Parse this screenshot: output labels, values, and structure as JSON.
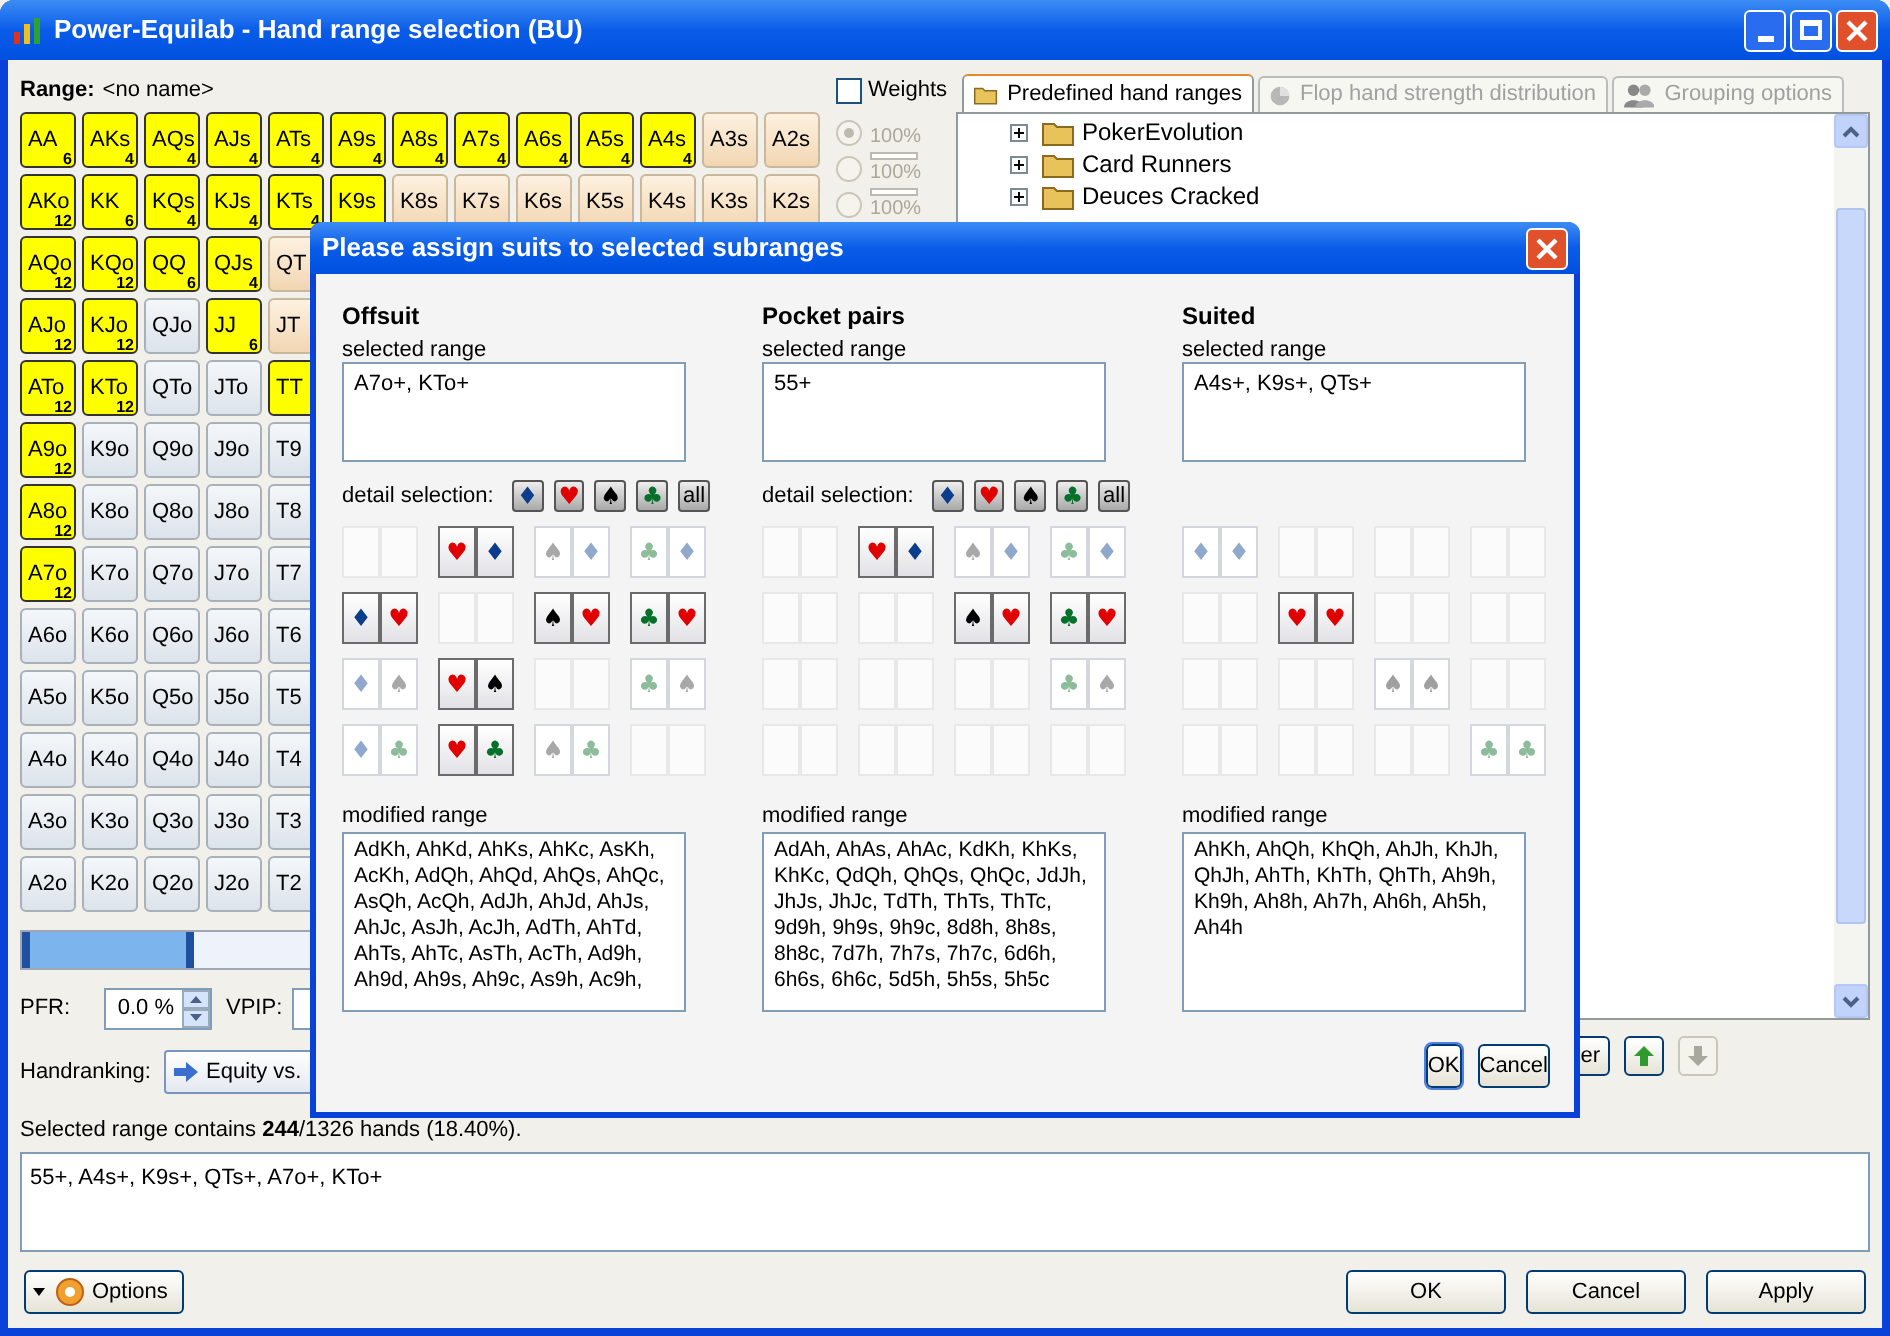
{
  "window": {
    "title": "Power-Equilab - Hand range selection (BU)"
  },
  "range": {
    "label": "Range:",
    "name": "<no name>"
  },
  "hand_grid": {
    "rows": [
      [
        {
          "label": "AA",
          "count": "6",
          "kind": "pair",
          "selected": true
        },
        {
          "label": "AKs",
          "count": "4",
          "kind": "suited",
          "selected": true
        },
        {
          "label": "AQs",
          "count": "4",
          "kind": "suited",
          "selected": true
        },
        {
          "label": "AJs",
          "count": "4",
          "kind": "suited",
          "selected": true
        },
        {
          "label": "ATs",
          "count": "4",
          "kind": "suited",
          "selected": true
        },
        {
          "label": "A9s",
          "count": "4",
          "kind": "suited",
          "selected": true
        },
        {
          "label": "A8s",
          "count": "4",
          "kind": "suited",
          "selected": true
        },
        {
          "label": "A7s",
          "count": "4",
          "kind": "suited",
          "selected": true
        },
        {
          "label": "A6s",
          "count": "4",
          "kind": "suited",
          "selected": true
        },
        {
          "label": "A5s",
          "count": "4",
          "kind": "suited",
          "selected": true
        },
        {
          "label": "A4s",
          "count": "4",
          "kind": "suited",
          "selected": true
        },
        {
          "label": "A3s",
          "kind": "suited",
          "selected": false
        },
        {
          "label": "A2s",
          "kind": "suited",
          "selected": false
        }
      ],
      [
        {
          "label": "AKo",
          "count": "12",
          "kind": "offsuit",
          "selected": true
        },
        {
          "label": "KK",
          "count": "6",
          "kind": "pair",
          "selected": true
        },
        {
          "label": "KQs",
          "count": "4",
          "kind": "suited",
          "selected": true
        },
        {
          "label": "KJs",
          "count": "4",
          "kind": "suited",
          "selected": true
        },
        {
          "label": "KTs",
          "count": "4",
          "kind": "suited",
          "selected": true
        },
        {
          "label": "K9s",
          "kind": "suited",
          "selected": true
        },
        {
          "label": "K8s",
          "kind": "suited",
          "selected": false
        },
        {
          "label": "K7s",
          "kind": "suited",
          "selected": false
        },
        {
          "label": "K6s",
          "kind": "suited",
          "selected": false
        },
        {
          "label": "K5s",
          "kind": "suited",
          "selected": false
        },
        {
          "label": "K4s",
          "kind": "suited",
          "selected": false
        },
        {
          "label": "K3s",
          "kind": "suited",
          "selected": false
        },
        {
          "label": "K2s",
          "kind": "suited",
          "selected": false
        }
      ],
      [
        {
          "label": "AQo",
          "count": "12",
          "kind": "offsuit",
          "selected": true
        },
        {
          "label": "KQo",
          "count": "12",
          "kind": "offsuit",
          "selected": true
        },
        {
          "label": "QQ",
          "count": "6",
          "kind": "pair",
          "selected": true
        },
        {
          "label": "QJs",
          "count": "4",
          "kind": "suited",
          "selected": true
        },
        {
          "label": "QT",
          "kind": "suited",
          "selected": false
        }
      ],
      [
        {
          "label": "AJo",
          "count": "12",
          "kind": "offsuit",
          "selected": true
        },
        {
          "label": "KJo",
          "count": "12",
          "kind": "offsuit",
          "selected": true
        },
        {
          "label": "QJo",
          "kind": "offsuit",
          "selected": false
        },
        {
          "label": "JJ",
          "count": "6",
          "kind": "pair",
          "selected": true
        },
        {
          "label": "JT",
          "kind": "suited",
          "selected": false
        }
      ],
      [
        {
          "label": "ATo",
          "count": "12",
          "kind": "offsuit",
          "selected": true
        },
        {
          "label": "KTo",
          "count": "12",
          "kind": "offsuit",
          "selected": true
        },
        {
          "label": "QTo",
          "kind": "offsuit",
          "selected": false
        },
        {
          "label": "JTo",
          "kind": "offsuit",
          "selected": false
        },
        {
          "label": "TT",
          "kind": "pair",
          "selected": true
        }
      ],
      [
        {
          "label": "A9o",
          "count": "12",
          "kind": "offsuit",
          "selected": true
        },
        {
          "label": "K9o",
          "kind": "offsuit",
          "selected": false
        },
        {
          "label": "Q9o",
          "kind": "offsuit",
          "selected": false
        },
        {
          "label": "J9o",
          "kind": "offsuit",
          "selected": false
        },
        {
          "label": "T9",
          "kind": "offsuit",
          "selected": false
        }
      ],
      [
        {
          "label": "A8o",
          "count": "12",
          "kind": "offsuit",
          "selected": true
        },
        {
          "label": "K8o",
          "kind": "offsuit",
          "selected": false
        },
        {
          "label": "Q8o",
          "kind": "offsuit",
          "selected": false
        },
        {
          "label": "J8o",
          "kind": "offsuit",
          "selected": false
        },
        {
          "label": "T8",
          "kind": "offsuit",
          "selected": false
        }
      ],
      [
        {
          "label": "A7o",
          "count": "12",
          "kind": "offsuit",
          "selected": true
        },
        {
          "label": "K7o",
          "kind": "offsuit",
          "selected": false
        },
        {
          "label": "Q7o",
          "kind": "offsuit",
          "selected": false
        },
        {
          "label": "J7o",
          "kind": "offsuit",
          "selected": false
        },
        {
          "label": "T7",
          "kind": "offsuit",
          "selected": false
        }
      ],
      [
        {
          "label": "A6o",
          "kind": "offsuit",
          "selected": false
        },
        {
          "label": "K6o",
          "kind": "offsuit",
          "selected": false
        },
        {
          "label": "Q6o",
          "kind": "offsuit",
          "selected": false
        },
        {
          "label": "J6o",
          "kind": "offsuit",
          "selected": false
        },
        {
          "label": "T6",
          "kind": "offsuit",
          "selected": false
        }
      ],
      [
        {
          "label": "A5o",
          "kind": "offsuit",
          "selected": false
        },
        {
          "label": "K5o",
          "kind": "offsuit",
          "selected": false
        },
        {
          "label": "Q5o",
          "kind": "offsuit",
          "selected": false
        },
        {
          "label": "J5o",
          "kind": "offsuit",
          "selected": false
        },
        {
          "label": "T5",
          "kind": "offsuit",
          "selected": false
        }
      ],
      [
        {
          "label": "A4o",
          "kind": "offsuit",
          "selected": false
        },
        {
          "label": "K4o",
          "kind": "offsuit",
          "selected": false
        },
        {
          "label": "Q4o",
          "kind": "offsuit",
          "selected": false
        },
        {
          "label": "J4o",
          "kind": "offsuit",
          "selected": false
        },
        {
          "label": "T4",
          "kind": "offsuit",
          "selected": false
        }
      ],
      [
        {
          "label": "A3o",
          "kind": "offsuit",
          "selected": false
        },
        {
          "label": "K3o",
          "kind": "offsuit",
          "selected": false
        },
        {
          "label": "Q3o",
          "kind": "offsuit",
          "selected": false
        },
        {
          "label": "J3o",
          "kind": "offsuit",
          "selected": false
        },
        {
          "label": "T3",
          "kind": "offsuit",
          "selected": false
        }
      ],
      [
        {
          "label": "A2o",
          "kind": "offsuit",
          "selected": false
        },
        {
          "label": "K2o",
          "kind": "offsuit",
          "selected": false
        },
        {
          "label": "Q2o",
          "kind": "offsuit",
          "selected": false
        },
        {
          "label": "J2o",
          "kind": "offsuit",
          "selected": false
        },
        {
          "label": "T2",
          "kind": "offsuit",
          "selected": false
        }
      ]
    ]
  },
  "weights": {
    "label": "Weights",
    "checked": false,
    "options": [
      {
        "label": "100%",
        "kind": "plain",
        "selected": true
      },
      {
        "label": "100%",
        "kind": "bar",
        "selected": false
      },
      {
        "label": "100%",
        "kind": "bar",
        "selected": false
      }
    ]
  },
  "tabs": [
    {
      "label": "Predefined hand ranges",
      "selected": true,
      "disabled": false
    },
    {
      "label": "Flop hand strength distribution",
      "selected": false,
      "disabled": true
    },
    {
      "label": "Grouping options",
      "selected": false,
      "disabled": true
    }
  ],
  "tree": [
    {
      "label": "PokerEvolution",
      "expanded": false
    },
    {
      "label": "Card Runners",
      "expanded": false
    },
    {
      "label": "Deuces Cracked",
      "expanded": false
    }
  ],
  "panel_buttons": [
    {
      "kind": "text",
      "label": "er"
    },
    {
      "kind": "up",
      "disabled": false
    },
    {
      "kind": "down",
      "disabled": true
    }
  ],
  "slider": {
    "level": 0.29
  },
  "pfr": {
    "label": "PFR:",
    "value": "0.0 %"
  },
  "vpip": {
    "label": "VPIP:"
  },
  "handranking": {
    "label": "Handranking:",
    "button": "Equity vs."
  },
  "summary": "Selected range contains **244**/1326 hands (18.40%).",
  "range_text": "55+, A4s+, K9s+, QTs+, A7o+, KTo+",
  "bottom": {
    "options": "Options",
    "buttons": [
      "OK",
      "Cancel",
      "Apply"
    ]
  },
  "dialog": {
    "title": "Please assign suits to selected subranges",
    "sections": [
      {
        "heading": "Offsuit",
        "selected_label": "selected range",
        "selected_value": "A7o+, KTo+",
        "detail_label": "detail selection:",
        "detail_buttons": [
          {
            "kind": "suit",
            "suit": "♦",
            "color": "#0b3d8c"
          },
          {
            "kind": "suit",
            "suit": "♥",
            "color": "#e00000"
          },
          {
            "kind": "suit",
            "suit": "♠",
            "color": "#000000"
          },
          {
            "kind": "suit",
            "suit": "♣",
            "color": "#05702a"
          },
          {
            "kind": "text",
            "label": "all"
          }
        ],
        "combos": [
          [
            {
              "kind": "blank"
            },
            {
              "kind": "pair",
              "cards": [
                {
                  "suit": "♥",
                  "color": "#e00000"
                },
                {
                  "suit": "♦",
                  "color": "#0b3d8c"
                }
              ],
              "selected": true
            },
            {
              "kind": "pair",
              "cards": [
                {
                  "suit": "♠",
                  "color": "#a8a8a8"
                },
                {
                  "suit": "♦",
                  "color": "#8fa8cc"
                }
              ],
              "selected": false
            },
            {
              "kind": "pair",
              "cards": [
                {
                  "suit": "♣",
                  "color": "#8cbc9a"
                },
                {
                  "suit": "♦",
                  "color": "#8fa8cc"
                }
              ],
              "selected": false
            }
          ],
          [
            {
              "kind": "pair",
              "cards": [
                {
                  "suit": "♦",
                  "color": "#0b3d8c"
                },
                {
                  "suit": "♥",
                  "color": "#e00000"
                }
              ],
              "selected": true
            },
            {
              "kind": "blank"
            },
            {
              "kind": "pair",
              "cards": [
                {
                  "suit": "♠",
                  "color": "#000000"
                },
                {
                  "suit": "♥",
                  "color": "#e00000"
                }
              ],
              "selected": true
            },
            {
              "kind": "pair",
              "cards": [
                {
                  "suit": "♣",
                  "color": "#05702a"
                },
                {
                  "suit": "♥",
                  "color": "#e00000"
                }
              ],
              "selected": true
            }
          ],
          [
            {
              "kind": "pair",
              "cards": [
                {
                  "suit": "♦",
                  "color": "#8fa8cc"
                },
                {
                  "suit": "♠",
                  "color": "#a8a8a8"
                }
              ],
              "selected": false
            },
            {
              "kind": "pair",
              "cards": [
                {
                  "suit": "♥",
                  "color": "#e00000"
                },
                {
                  "suit": "♠",
                  "color": "#000000"
                }
              ],
              "selected": true
            },
            {
              "kind": "blank"
            },
            {
              "kind": "pair",
              "cards": [
                {
                  "suit": "♣",
                  "color": "#8cbc9a"
                },
                {
                  "suit": "♠",
                  "color": "#a8a8a8"
                }
              ],
              "selected": false
            }
          ],
          [
            {
              "kind": "pair",
              "cards": [
                {
                  "suit": "♦",
                  "color": "#8fa8cc"
                },
                {
                  "suit": "♣",
                  "color": "#8cbc9a"
                }
              ],
              "selected": false
            },
            {
              "kind": "pair",
              "cards": [
                {
                  "suit": "♥",
                  "color": "#e00000"
                },
                {
                  "suit": "♣",
                  "color": "#05702a"
                }
              ],
              "selected": true
            },
            {
              "kind": "pair",
              "cards": [
                {
                  "suit": "♠",
                  "color": "#a8a8a8"
                },
                {
                  "suit": "♣",
                  "color": "#8cbc9a"
                }
              ],
              "selected": false
            },
            {
              "kind": "blank"
            }
          ]
        ],
        "modified_label": "modified range",
        "modified_value": "AdKh, AhKd, AhKs, AhKc, AsKh, AcKh, AdQh, AhQd, AhQs, AhQc, AsQh, AcQh, AdJh, AhJd, AhJs, AhJc, AsJh, AcJh, AdTh, AhTd, AhTs, AhTc, AsTh, AcTh, Ad9h, Ah9d, Ah9s, Ah9c, As9h, Ac9h,"
      },
      {
        "heading": "Pocket pairs",
        "selected_label": "selected range",
        "selected_value": "55+",
        "detail_label": "detail selection:",
        "detail_buttons": [
          {
            "kind": "suit",
            "suit": "♦",
            "color": "#0b3d8c"
          },
          {
            "kind": "suit",
            "suit": "♥",
            "color": "#e00000"
          },
          {
            "kind": "suit",
            "suit": "♠",
            "color": "#000000"
          },
          {
            "kind": "suit",
            "suit": "♣",
            "color": "#05702a"
          },
          {
            "kind": "text",
            "label": "all"
          }
        ],
        "combos": [
          [
            {
              "kind": "blank"
            },
            {
              "kind": "pair",
              "cards": [
                {
                  "suit": "♥",
                  "color": "#e00000"
                },
                {
                  "suit": "♦",
                  "color": "#0b3d8c"
                }
              ],
              "selected": true
            },
            {
              "kind": "pair",
              "cards": [
                {
                  "suit": "♠",
                  "color": "#a8a8a8"
                },
                {
                  "suit": "♦",
                  "color": "#8fa8cc"
                }
              ],
              "selected": false
            },
            {
              "kind": "pair",
              "cards": [
                {
                  "suit": "♣",
                  "color": "#8cbc9a"
                },
                {
                  "suit": "♦",
                  "color": "#8fa8cc"
                }
              ],
              "selected": false
            }
          ],
          [
            {
              "kind": "blank"
            },
            {
              "kind": "blank"
            },
            {
              "kind": "pair",
              "cards": [
                {
                  "suit": "♠",
                  "color": "#000000"
                },
                {
                  "suit": "♥",
                  "color": "#e00000"
                }
              ],
              "selected": true
            },
            {
              "kind": "pair",
              "cards": [
                {
                  "suit": "♣",
                  "color": "#05702a"
                },
                {
                  "suit": "♥",
                  "color": "#e00000"
                }
              ],
              "selected": true
            }
          ],
          [
            {
              "kind": "blank"
            },
            {
              "kind": "blank"
            },
            {
              "kind": "blank"
            },
            {
              "kind": "pair",
              "cards": [
                {
                  "suit": "♣",
                  "color": "#8cbc9a"
                },
                {
                  "suit": "♠",
                  "color": "#a8a8a8"
                }
              ],
              "selected": false
            }
          ],
          [
            {
              "kind": "blank"
            },
            {
              "kind": "blank"
            },
            {
              "kind": "blank"
            },
            {
              "kind": "blank"
            }
          ]
        ],
        "modified_label": "modified range",
        "modified_value": "AdAh, AhAs, AhAc, KdKh, KhKs, KhKc, QdQh, QhQs, QhQc, JdJh, JhJs, JhJc, TdTh, ThTs, ThTc, 9d9h, 9h9s, 9h9c, 8d8h, 8h8s, 8h8c, 7d7h, 7h7s, 7h7c, 6d6h, 6h6s, 6h6c, 5d5h, 5h5s, 5h5c"
      },
      {
        "heading": "Suited",
        "selected_label": "selected range",
        "selected_value": "A4s+, K9s+, QTs+",
        "combos": [
          [
            {
              "kind": "pair",
              "cards": [
                {
                  "suit": "♦",
                  "color": "#8fa8cc"
                },
                {
                  "suit": "♦",
                  "color": "#8fa8cc"
                }
              ],
              "selected": false
            },
            {
              "kind": "blank"
            },
            {
              "kind": "blank"
            },
            {
              "kind": "blank"
            }
          ],
          [
            {
              "kind": "blank"
            },
            {
              "kind": "pair",
              "cards": [
                {
                  "suit": "♥",
                  "color": "#e00000"
                },
                {
                  "suit": "♥",
                  "color": "#e00000"
                }
              ],
              "selected": true
            },
            {
              "kind": "blank"
            },
            {
              "kind": "blank"
            }
          ],
          [
            {
              "kind": "blank"
            },
            {
              "kind": "blank"
            },
            {
              "kind": "pair",
              "cards": [
                {
                  "suit": "♠",
                  "color": "#a0a0a0"
                },
                {
                  "suit": "♠",
                  "color": "#a0a0a0"
                }
              ],
              "selected": false
            },
            {
              "kind": "blank"
            }
          ],
          [
            {
              "kind": "blank"
            },
            {
              "kind": "blank"
            },
            {
              "kind": "blank"
            },
            {
              "kind": "pair",
              "cards": [
                {
                  "suit": "♣",
                  "color": "#8cbc9a"
                },
                {
                  "suit": "♣",
                  "color": "#8cbc9a"
                }
              ],
              "selected": false
            }
          ]
        ],
        "modified_label": "modified range",
        "modified_value": "AhKh, AhQh, KhQh, AhJh, KhJh, QhJh, AhTh, KhTh, QhTh, Ah9h, Kh9h, Ah8h, Ah7h, Ah6h, Ah5h, Ah4h"
      }
    ],
    "buttons": [
      "OK",
      "Cancel"
    ]
  }
}
